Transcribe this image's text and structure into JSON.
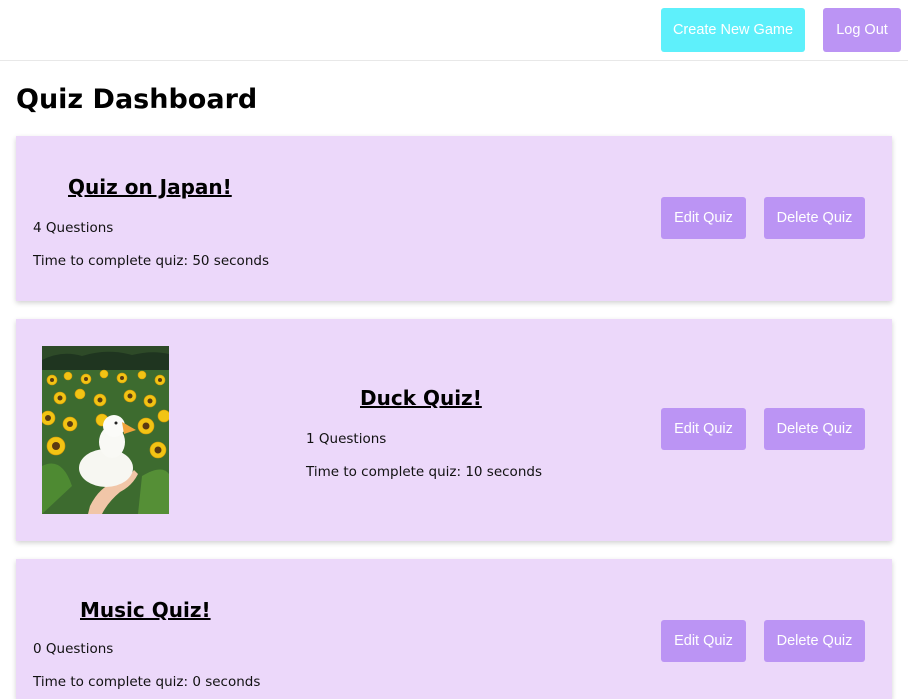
{
  "header": {
    "create_label": "Create New Game",
    "logout_label": "Log Out"
  },
  "page": {
    "title": "Quiz Dashboard"
  },
  "quizzes": [
    {
      "title": "Quiz on Japan!",
      "questions": "4 Questions",
      "time": "Time to complete quiz: 50 seconds",
      "edit_label": "Edit Quiz",
      "delete_label": "Delete Quiz"
    },
    {
      "title": "Duck Quiz!",
      "questions": "1 Questions",
      "time": "Time to complete quiz: 10 seconds",
      "edit_label": "Edit Quiz",
      "delete_label": "Delete Quiz",
      "thumbnail": "duck-in-sunflower-field"
    },
    {
      "title": "Music Quiz!",
      "questions": "0 Questions",
      "time": "Time to complete quiz: 0 seconds",
      "edit_label": "Edit Quiz",
      "delete_label": "Delete Quiz"
    }
  ],
  "colors": {
    "card_bg": "#ecd8fa",
    "primary_button": "#bb94f4",
    "create_button": "#5ef0fb"
  }
}
